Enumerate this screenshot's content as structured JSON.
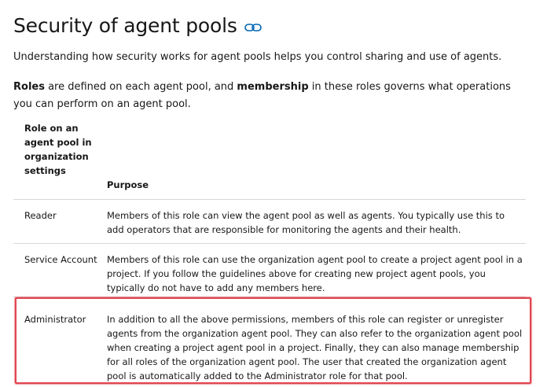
{
  "heading": {
    "title": "Security of agent pools",
    "anchor_icon": "link-icon"
  },
  "intro_text": "Understanding how security works for agent pools helps you control sharing and use of agents.",
  "roles_paragraph": {
    "term1": "Roles",
    "text1": " are defined on each agent pool, and ",
    "term2": "membership",
    "text2": " in these roles governs what operations you can perform on an agent pool."
  },
  "table": {
    "headers": {
      "role": "Role on an agent pool in organization settings",
      "purpose": "Purpose"
    },
    "rows": [
      {
        "role": "Reader",
        "purpose": "Members of this role can view the agent pool as well as agents. You typically use this to add operators that are responsible for monitoring the agents and their health."
      },
      {
        "role": "Service Account",
        "purpose": "Members of this role can use the organization agent pool to create a project agent pool in a project. If you follow the guidelines above for creating new project agent pools, you typically do not have to add any members here."
      },
      {
        "role": "Administrator",
        "purpose": "In addition to all the above permissions, members of this role can register or unregister agents from the organization agent pool. They can also refer to the organization agent pool when creating a project agent pool in a project. Finally, they can also manage membership for all roles of the organization agent pool. The user that created the organization agent pool is automatically added to the Administrator role for that pool."
      }
    ]
  },
  "colors": {
    "text": "#171717",
    "link_icon": "#0065b3",
    "highlight_border": "#e0454f",
    "row_divider": "#d6d6d6"
  }
}
